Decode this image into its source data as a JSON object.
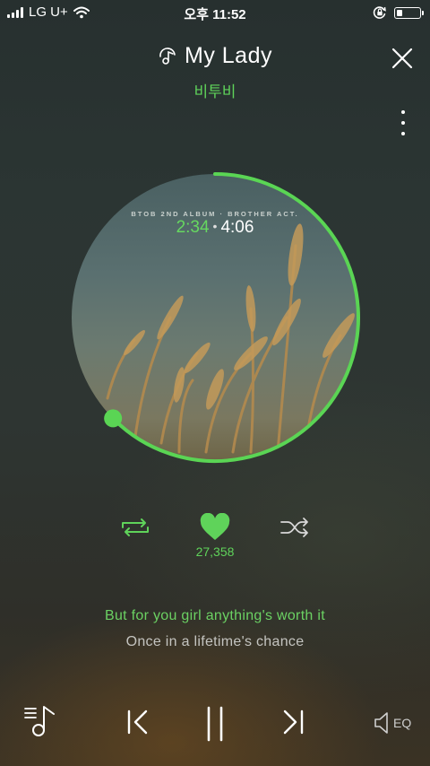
{
  "status_bar": {
    "carrier": "LG U+",
    "time": "오후 11:52",
    "battery_level": 0.25,
    "icons": [
      "signal-bars-icon",
      "wifi-icon",
      "orientation-lock-icon",
      "battery-icon"
    ]
  },
  "player": {
    "song_title": "My Lady",
    "artist": "비투비",
    "album_caption": "BTOB 2ND ALBUM · BROTHER ACT.",
    "current_time": "2:34",
    "time_separator": "•",
    "total_time": "4:06",
    "progress_fraction": 0.626,
    "like_count": "27,358",
    "lyrics": {
      "current": "But for you girl anything's worth it",
      "next": "Once in a lifetime's chance"
    },
    "eq_label": "EQ"
  },
  "icons": {
    "title": "music-note-icon",
    "close": "close-icon",
    "more": "more-vertical-icon",
    "repeat": "repeat-icon",
    "like": "heart-icon",
    "shuffle": "shuffle-icon",
    "playlist": "playlist-icon",
    "prev": "previous-icon",
    "pause": "pause-icon",
    "next": "next-icon",
    "eq": "speaker-icon"
  },
  "colors": {
    "accent": "#5fd35a",
    "progress": "#5ad554",
    "background": "#2b3533"
  }
}
